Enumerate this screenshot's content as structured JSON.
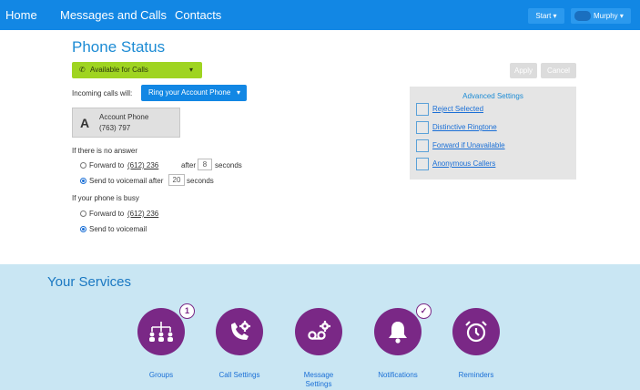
{
  "nav": {
    "home": "Home",
    "messages": "Messages and Calls",
    "contacts": "Contacts",
    "start": "Start ▾",
    "user": "Murphy ▾"
  },
  "phone_status": {
    "title": "Phone Status",
    "status_value": "Available for Calls",
    "incoming_label": "Incoming calls will:",
    "ring_value": "Ring your Account Phone",
    "account": {
      "letter": "A",
      "name": "Account Phone",
      "number": "(763) 797"
    },
    "no_answer": {
      "label": "If there is no answer",
      "forward_text": "Forward to",
      "forward_number": "(612) 236",
      "after_text": "after",
      "forward_seconds": "8",
      "seconds_text": "seconds",
      "voicemail_text": "Send to voicemail after",
      "voicemail_seconds": "20",
      "voicemail_seconds_text": "seconds",
      "selected": "voicemail"
    },
    "busy": {
      "label": "If your phone is busy",
      "forward_text": "Forward to",
      "forward_number": "(612) 236",
      "voicemail_text": "Send to voicemail",
      "selected": "voicemail"
    }
  },
  "actions": {
    "apply": "Apply",
    "cancel": "Cancel"
  },
  "advanced": {
    "title": "Advanced Settings",
    "items": [
      {
        "label": "Reject Selected"
      },
      {
        "label": "Distinctive Ringtone"
      },
      {
        "label": "Forward if Unavailable"
      },
      {
        "label": "Anonymous Callers"
      }
    ]
  },
  "services": {
    "title": "Your Services",
    "items": [
      {
        "label": "Groups",
        "icon": "groups-icon",
        "badge": "1"
      },
      {
        "label": "Call Settings",
        "icon": "call-settings-icon"
      },
      {
        "label": "Message\nSettings",
        "icon": "voicemail-settings-icon"
      },
      {
        "label": "Notifications",
        "icon": "bell-icon",
        "badge": "✓"
      },
      {
        "label": "Reminders",
        "icon": "alarm-clock-icon"
      }
    ]
  },
  "colors": {
    "nav_bg": "#1287e4",
    "status_green": "#9fd421",
    "service_purple": "#7a2886",
    "services_bg": "#c9e6f3"
  }
}
